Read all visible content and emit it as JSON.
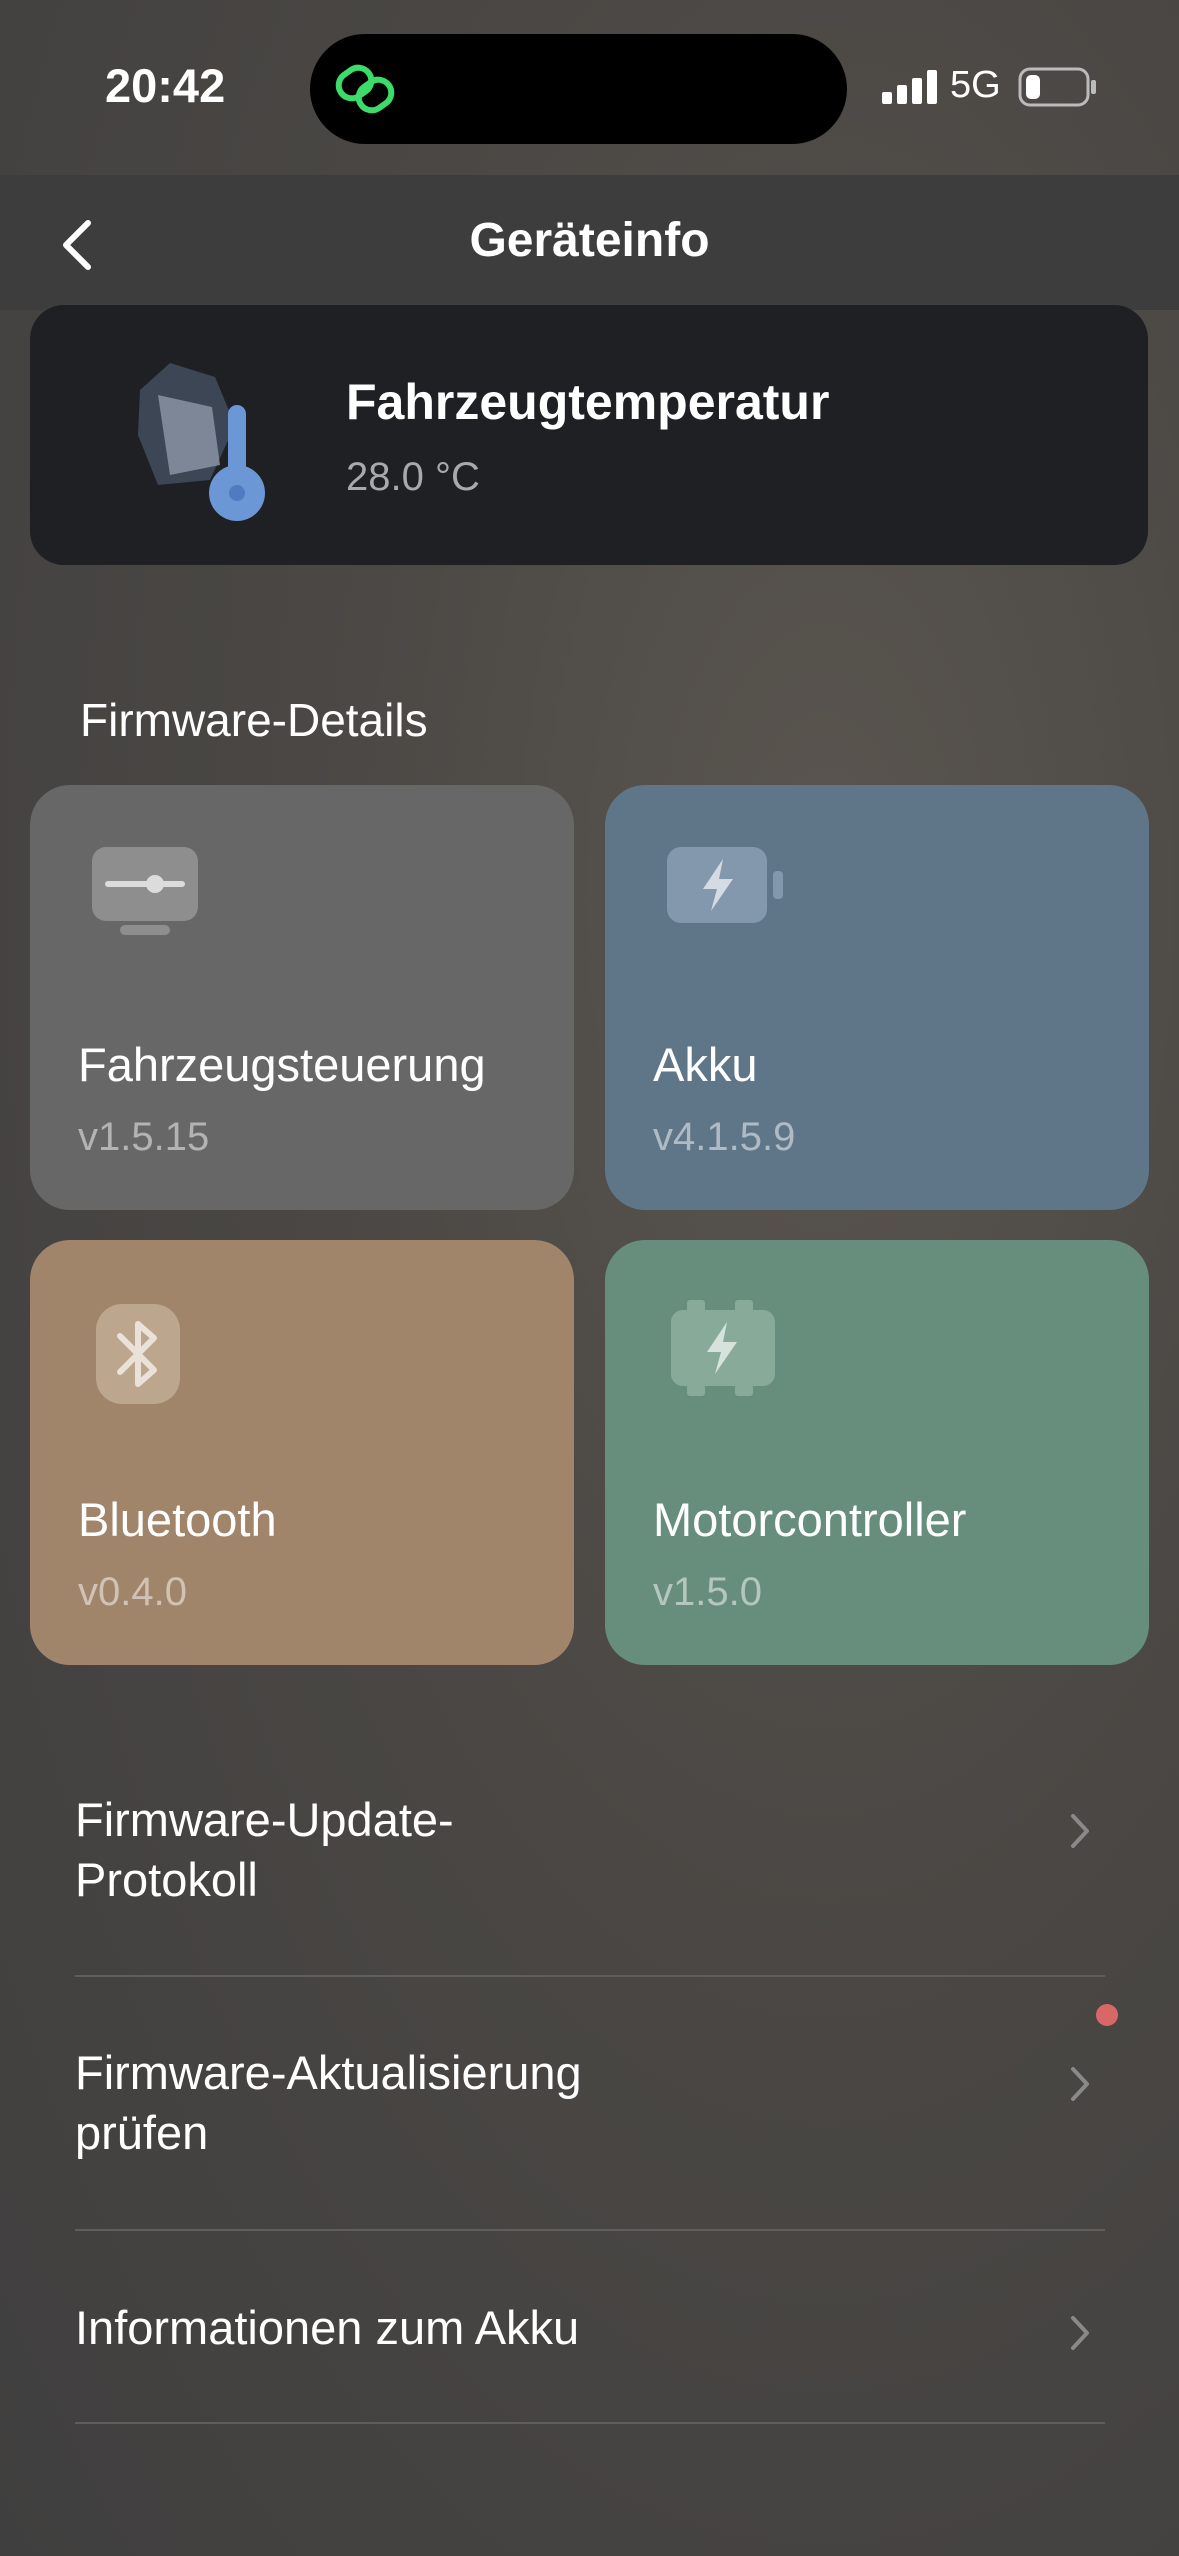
{
  "status_bar": {
    "time": "20:42",
    "network": "5G",
    "battery_level": 0.2
  },
  "nav": {
    "title": "Geräteinfo"
  },
  "temperature_card": {
    "label": "Fahrzeugtemperatur",
    "value": "28.0 °C"
  },
  "firmware": {
    "section_title": "Firmware-Details",
    "tiles": [
      {
        "name": "Fahrzeugsteuerung",
        "version": "v1.5.15",
        "icon": "controller-icon",
        "color": "#676767"
      },
      {
        "name": "Akku",
        "version": "v4.1.5.9",
        "icon": "battery-icon",
        "color": "#5f7588"
      },
      {
        "name": "Bluetooth",
        "version": "v0.4.0",
        "icon": "bluetooth-icon",
        "color": "#a0856a"
      },
      {
        "name": "Motorcontroller",
        "version": "v1.5.0",
        "icon": "motor-icon",
        "color": "#678e7c"
      }
    ]
  },
  "menu": {
    "items": [
      {
        "label_line1": "Firmware-Update-",
        "label_line2": "Protokoll",
        "has_badge": false
      },
      {
        "label_line1": "Firmware-Aktualisierung",
        "label_line2": "prüfen",
        "has_badge": true
      },
      {
        "label_line1": "Informationen zum Akku",
        "label_line2": "",
        "has_badge": false
      }
    ]
  },
  "colors": {
    "accent_green": "#3ddc6a",
    "badge_red": "#d86868"
  }
}
